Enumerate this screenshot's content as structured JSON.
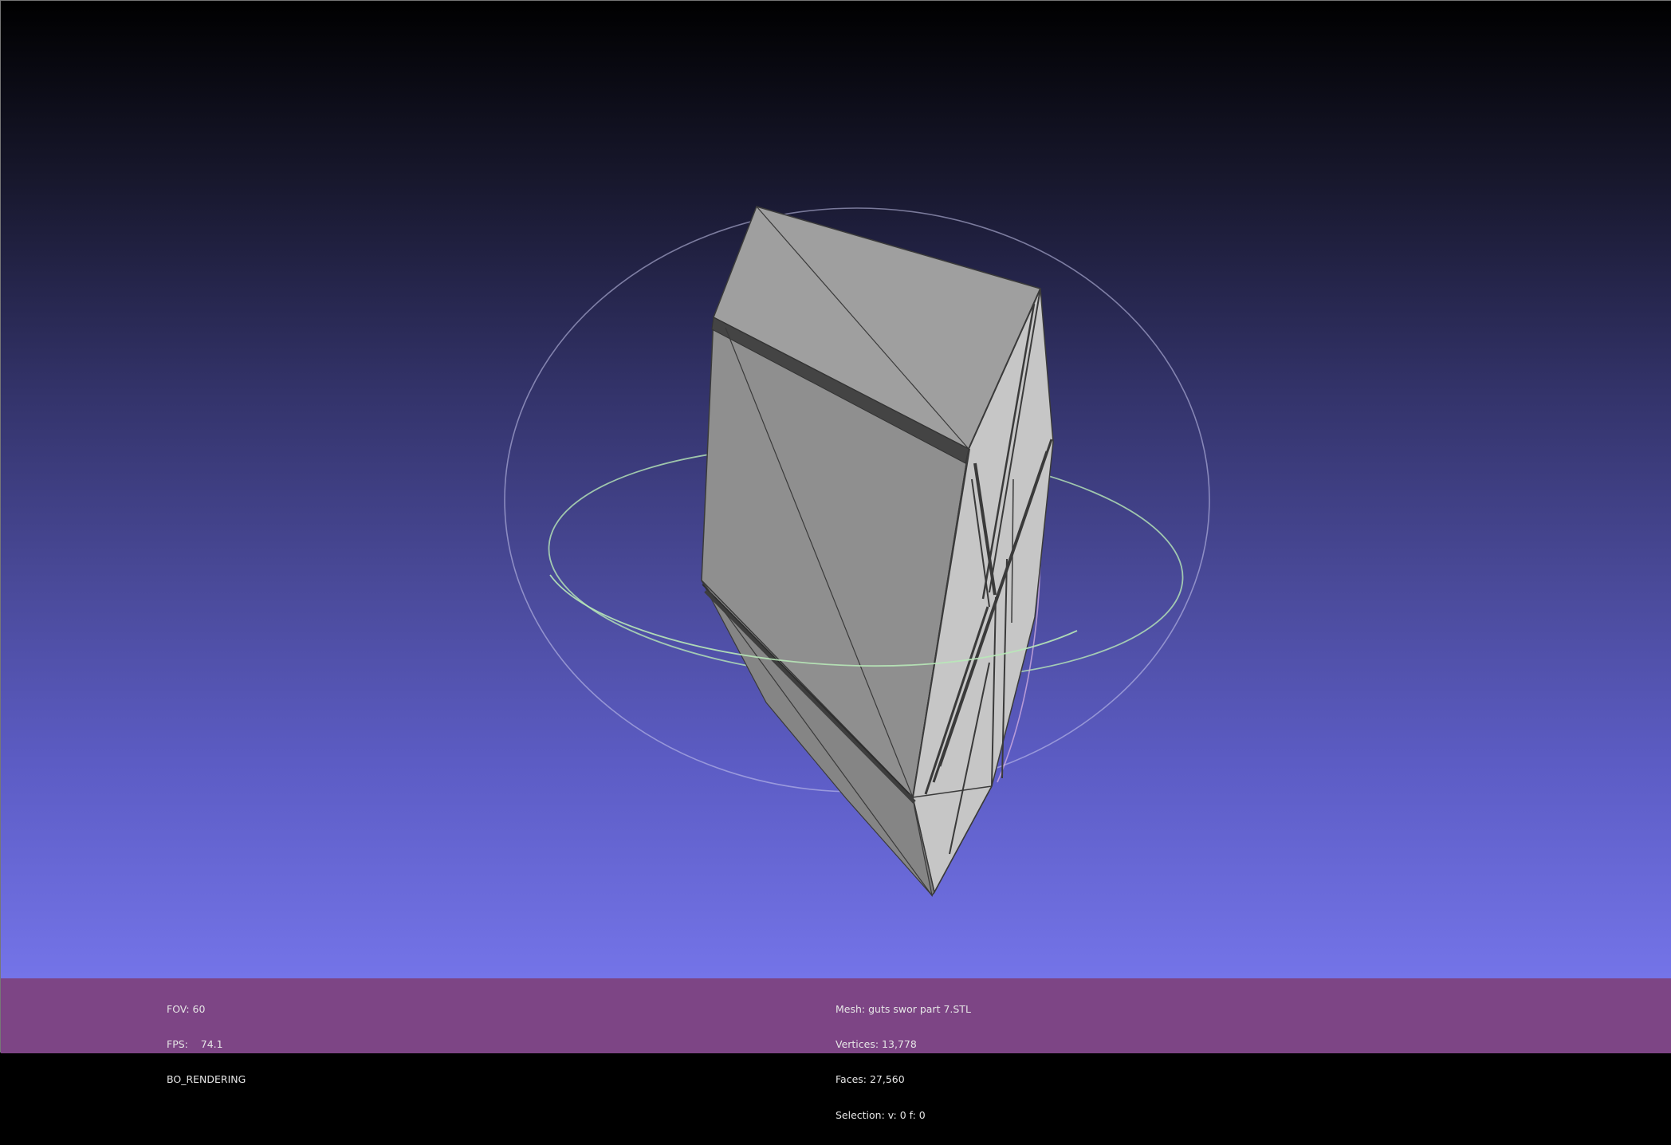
{
  "viewport": {
    "background_top": "#000000",
    "background_bottom": "#7474e8",
    "mesh_color": "#9a9a9a",
    "trackball_colors": {
      "horizontal": "#b8e8b8",
      "vertical": "#e0b8e6",
      "rear": "#c8c8ee"
    }
  },
  "info_bar": {
    "background": "#7d4585",
    "left": {
      "fov": "FOV: 60",
      "fps": "FPS:    74.1",
      "render_mode": "BO_RENDERING"
    },
    "right": {
      "mesh": "Mesh: guts swor part 7.STL",
      "vertices": "Vertices: 13,778",
      "faces": "Faces: 27,560",
      "selection": "Selection: v: 0 f: 0"
    }
  }
}
